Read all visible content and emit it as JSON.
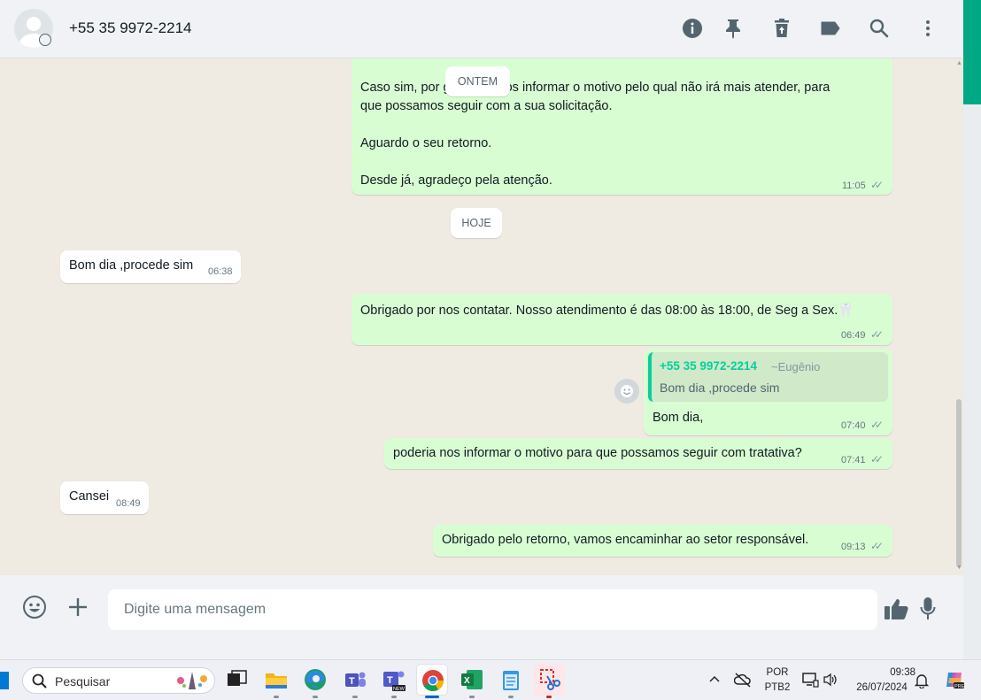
{
  "header": {
    "contact_name": "+55 35 9972-2214",
    "icons": [
      "info-icon",
      "pin-icon",
      "delete-icon",
      "label-icon",
      "search-icon",
      "menu-icon"
    ]
  },
  "chat": {
    "day_yesterday": "ONTEM",
    "day_today": "HOJE",
    "msg1": {
      "line1": "Caso sim, por gentileza nos informar o motivo pelo qual não irá mais atender, para",
      "line2": "que possamos seguir com a sua solicitação.",
      "line3": "Aguardo o seu retorno.",
      "line4": "Desde já, agradeço pela atenção.",
      "time": "11:05"
    },
    "msg2": {
      "text": "Bom dia ,procede sim",
      "time": "06:38"
    },
    "msg3": {
      "text": "Obrigado por nos contatar. Nosso atendimento é das 08:00 às 18:00, de Seg a Sex.🦷",
      "time": "06:49"
    },
    "msg4": {
      "quote_author": "+55 35 9972-2214",
      "quote_alias": "~Eugênio",
      "quote_text": "Bom dia ,procede sim",
      "text": "Bom dia,",
      "time": "07:40"
    },
    "msg5": {
      "text": "poderia nos informar o motivo para que possamos seguir com tratativa?",
      "time": "07:41"
    },
    "msg6": {
      "text": "Cansei",
      "time": "08:49"
    },
    "msg7": {
      "text": "Obrigado pelo retorno, vamos encaminhar ao setor responsável.",
      "time": "09:13"
    }
  },
  "inputbar": {
    "placeholder": "Digite uma mensagem"
  },
  "taskbar": {
    "search_label": "Pesquisar",
    "lang_line1": "POR",
    "lang_line2": "PTB2",
    "clock_time": "09:38",
    "clock_date": "26/07/2024"
  },
  "colors": {
    "accent": "#00a884",
    "outgoing_bubble": "#d9fdd3",
    "incoming_bubble": "#ffffff",
    "chat_bg": "#efeae2"
  }
}
